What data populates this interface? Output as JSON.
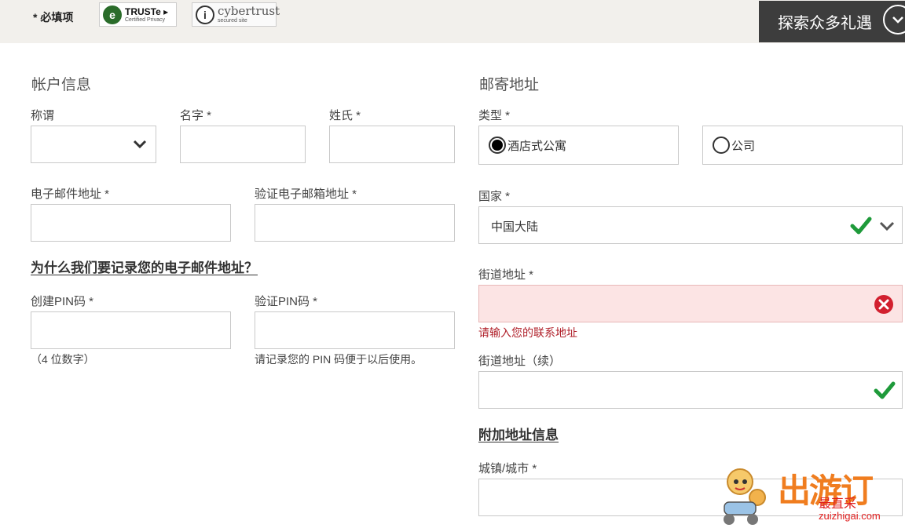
{
  "header": {
    "required_note": "* 必填项",
    "truste": {
      "title": "TRUSTe ▸",
      "sub": "Certified Privacy"
    },
    "cybertrust": {
      "title": "cybertrust",
      "sub": "secured site"
    },
    "explore_label": "探索众多礼遇"
  },
  "account": {
    "title": "帐户信息",
    "salutation_label": "称谓",
    "first_name_label": "名字 *",
    "last_name_label": "姓氏 *",
    "email_label": "电子邮件地址 *",
    "verify_email_label": "验证电子邮箱地址 *",
    "why_email_link": "为什么我们要记录您的电子邮件地址？",
    "pin_label": "创建PIN码 *",
    "verify_pin_label": "验证PIN码 *",
    "pin_hint": "（4 位数字）",
    "verify_pin_hint": "请记录您的 PIN 码便于以后使用。"
  },
  "mailing": {
    "title": "邮寄地址",
    "type_label": "类型 *",
    "type_options": [
      "酒店式公寓",
      "公司"
    ],
    "type_selected": "酒店式公寓",
    "country_label": "国家 *",
    "country_value": "中国大陆",
    "street_label": "街道地址 *",
    "street_error": "请输入您的联系地址",
    "street2_label": "街道地址（续）",
    "additional_link": "附加地址信息",
    "city_label": "城镇/城市 *"
  },
  "watermark": {
    "logo": "出游订",
    "slogan": "最直采",
    "site": "zuizhigai.com"
  },
  "colors": {
    "check": "#1e9a3a",
    "error_icon": "#d2202f",
    "error_bg": "#fce4e4",
    "dark_button": "#3d3d3d"
  }
}
